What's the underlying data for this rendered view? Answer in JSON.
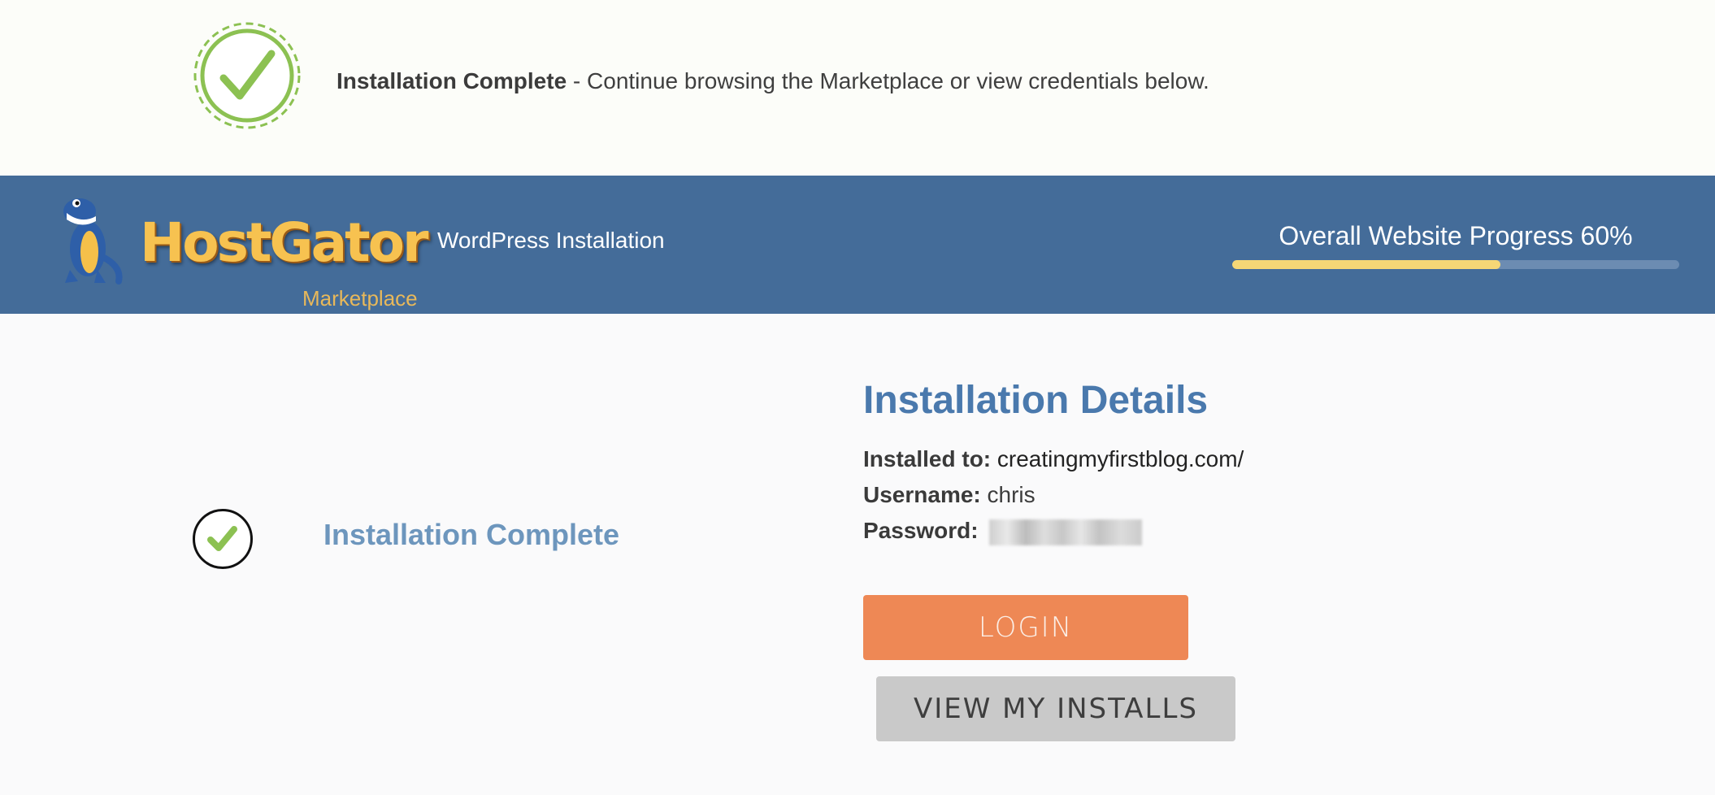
{
  "notice": {
    "strong": "Installation Complete",
    "message": " - Continue browsing the Marketplace or view credentials below."
  },
  "header": {
    "brand": "HostGator",
    "brand_sub": "Marketplace",
    "title": "WordPress Installation",
    "progress_label": "Overall Website Progress 60%",
    "progress_value": 0.6
  },
  "status": {
    "title": "Installation Complete"
  },
  "details": {
    "heading": "Installation Details",
    "installed_to_label": "Installed to:",
    "installed_to_value": "creatingmyfirstblog.com/",
    "username_label": "Username:",
    "username_value": "chris",
    "password_label": "Password:"
  },
  "buttons": {
    "login": "LOGIN",
    "view_installs": "VIEW MY INSTALLS"
  },
  "colors": {
    "header_band": "#446c99",
    "progress_fill": "#f5d776",
    "check_green": "#8cc152",
    "login_button": "#ee8855",
    "installs_button": "#c9c9c9",
    "heading_blue": "#4a79ad"
  },
  "icons": {
    "notice": "dashed-circle-check-icon",
    "status": "circle-check-icon",
    "mascot": "gator-mascot-icon"
  }
}
